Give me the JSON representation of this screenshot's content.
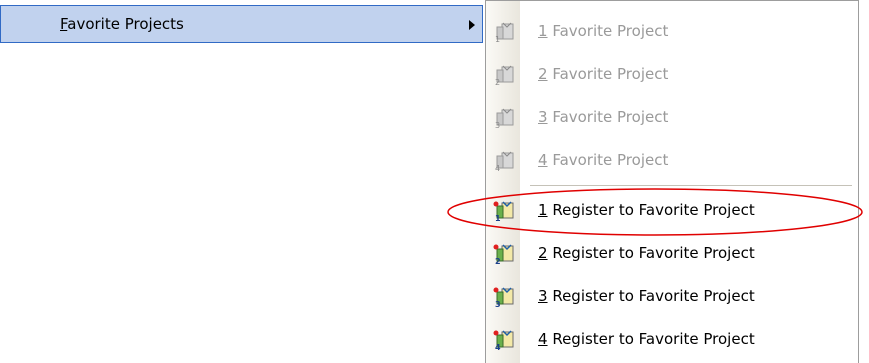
{
  "parent_menu": {
    "label_accel": "F",
    "label_rest": "avorite Projects"
  },
  "submenu": {
    "favorites": [
      {
        "accel": "1",
        "rest": " Favorite Project",
        "icon_number": "1",
        "enabled": false
      },
      {
        "accel": "2",
        "rest": " Favorite Project",
        "icon_number": "2",
        "enabled": false
      },
      {
        "accel": "3",
        "rest": " Favorite Project",
        "icon_number": "3",
        "enabled": false
      },
      {
        "accel": "4",
        "rest": " Favorite Project",
        "icon_number": "4",
        "enabled": false
      }
    ],
    "register": [
      {
        "accel": "1",
        "rest": " Register to Favorite Project",
        "icon_number": "1",
        "enabled": true
      },
      {
        "accel": "2",
        "rest": " Register to Favorite Project",
        "icon_number": "2",
        "enabled": true
      },
      {
        "accel": "3",
        "rest": " Register to Favorite Project",
        "icon_number": "3",
        "enabled": true
      },
      {
        "accel": "4",
        "rest": " Register to Favorite Project",
        "icon_number": "4",
        "enabled": true
      }
    ]
  },
  "colors": {
    "highlight_bg": "#c1d2ee",
    "highlight_border": "#316ac5",
    "disabled_text": "#9a9a9a",
    "callout": "#e00000"
  },
  "icons": {
    "favorite_project": "favorite-project-icon",
    "register_favorite": "register-favorite-project-icon",
    "submenu_arrow": "submenu-arrow-icon"
  }
}
